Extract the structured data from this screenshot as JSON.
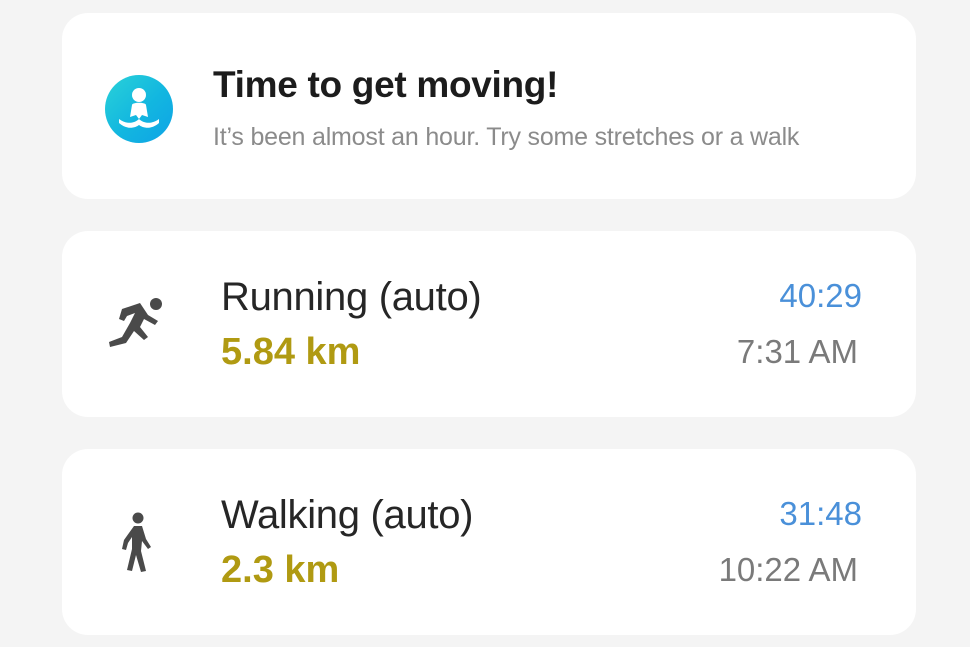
{
  "reminder": {
    "title": "Time to get moving!",
    "subtitle": "It’s been almost an hour. Try some stretches or a walk",
    "icon": "stretching-person-icon"
  },
  "activities": [
    {
      "name": "Running (auto)",
      "distance": "5.84 km",
      "duration": "40:29",
      "start_time": "7:31 AM",
      "icon": "running-icon"
    },
    {
      "name": "Walking (auto)",
      "distance": "2.3 km",
      "duration": "31:48",
      "start_time": "10:22 AM",
      "icon": "walking-icon"
    }
  ],
  "colors": {
    "background": "#f4f4f4",
    "card": "#ffffff",
    "distance": "#b09a12",
    "duration": "#4a90d9",
    "secondary_text": "#7a7a7a",
    "badge_gradient_start": "#2ad2d8",
    "badge_gradient_end": "#0fa3e6"
  }
}
